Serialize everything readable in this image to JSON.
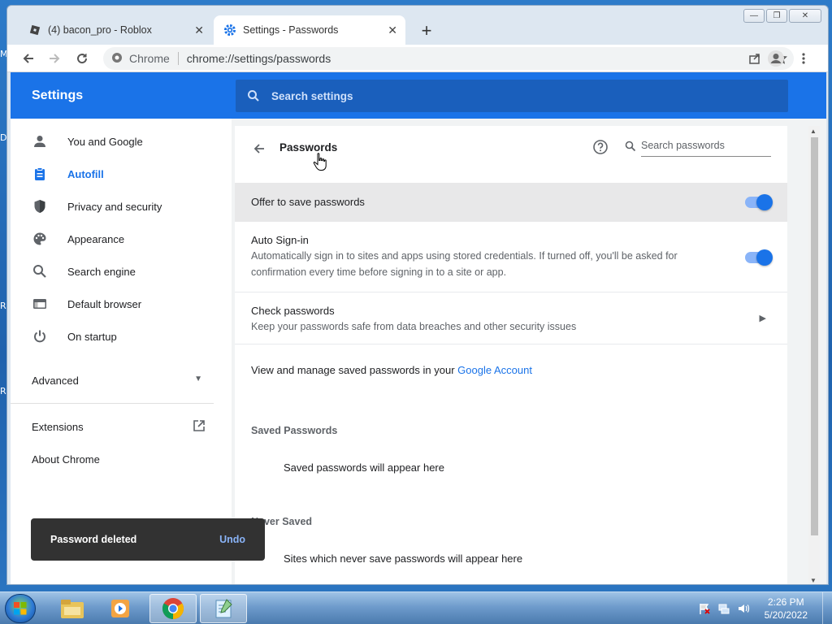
{
  "desktop": {
    "edge_labels": [
      "M",
      "D",
      "R",
      "R"
    ]
  },
  "browser": {
    "tabs": [
      {
        "title": "(4) bacon_pro - Roblox",
        "icon": "roblox-icon",
        "active": false
      },
      {
        "title": "Settings - Passwords",
        "icon": "gear-icon",
        "active": true
      }
    ],
    "omnibox": {
      "site_label": "Chrome",
      "url": "chrome://settings/passwords"
    }
  },
  "settings": {
    "title": "Settings",
    "search_placeholder": "Search settings",
    "sidebar": {
      "items": [
        {
          "label": "You and Google",
          "icon": "person-icon",
          "active": false
        },
        {
          "label": "Autofill",
          "icon": "clipboard-icon",
          "active": true
        },
        {
          "label": "Privacy and security",
          "icon": "shield-icon",
          "active": false
        },
        {
          "label": "Appearance",
          "icon": "palette-icon",
          "active": false
        },
        {
          "label": "Search engine",
          "icon": "search-icon",
          "active": false
        },
        {
          "label": "Default browser",
          "icon": "browser-window-icon",
          "active": false
        },
        {
          "label": "On startup",
          "icon": "power-icon",
          "active": false
        }
      ],
      "advanced_label": "Advanced",
      "extensions_label": "Extensions",
      "about_label": "About Chrome"
    },
    "passwords": {
      "title": "Passwords",
      "search_placeholder": "Search passwords",
      "offer_to_save": {
        "label": "Offer to save passwords",
        "enabled": true
      },
      "auto_signin": {
        "label": "Auto Sign-in",
        "description": "Automatically sign in to sites and apps using stored credentials. If turned off, you'll be asked for confirmation every time before signing in to a site or app.",
        "enabled": true
      },
      "check_passwords": {
        "label": "Check passwords",
        "description": "Keep your passwords safe from data breaches and other security issues"
      },
      "manage_text": "View and manage saved passwords in your",
      "manage_link": "Google Account",
      "saved_heading": "Saved Passwords",
      "saved_empty": "Saved passwords will appear here",
      "never_heading": "Never Saved",
      "never_empty": "Sites which never save passwords will appear here"
    },
    "toast": {
      "message": "Password deleted",
      "action": "Undo"
    }
  },
  "taskbar": {
    "apps": [
      "explorer-icon",
      "media-player-icon",
      "chrome-icon",
      "notepad-icon"
    ],
    "active_app": "chrome-icon",
    "time": "2:26 PM",
    "date": "5/20/2022"
  },
  "colors": {
    "accent": "#1a73e8",
    "header_bg": "#1a73e8",
    "toast_bg": "#323232",
    "link": "#1a73e8"
  }
}
